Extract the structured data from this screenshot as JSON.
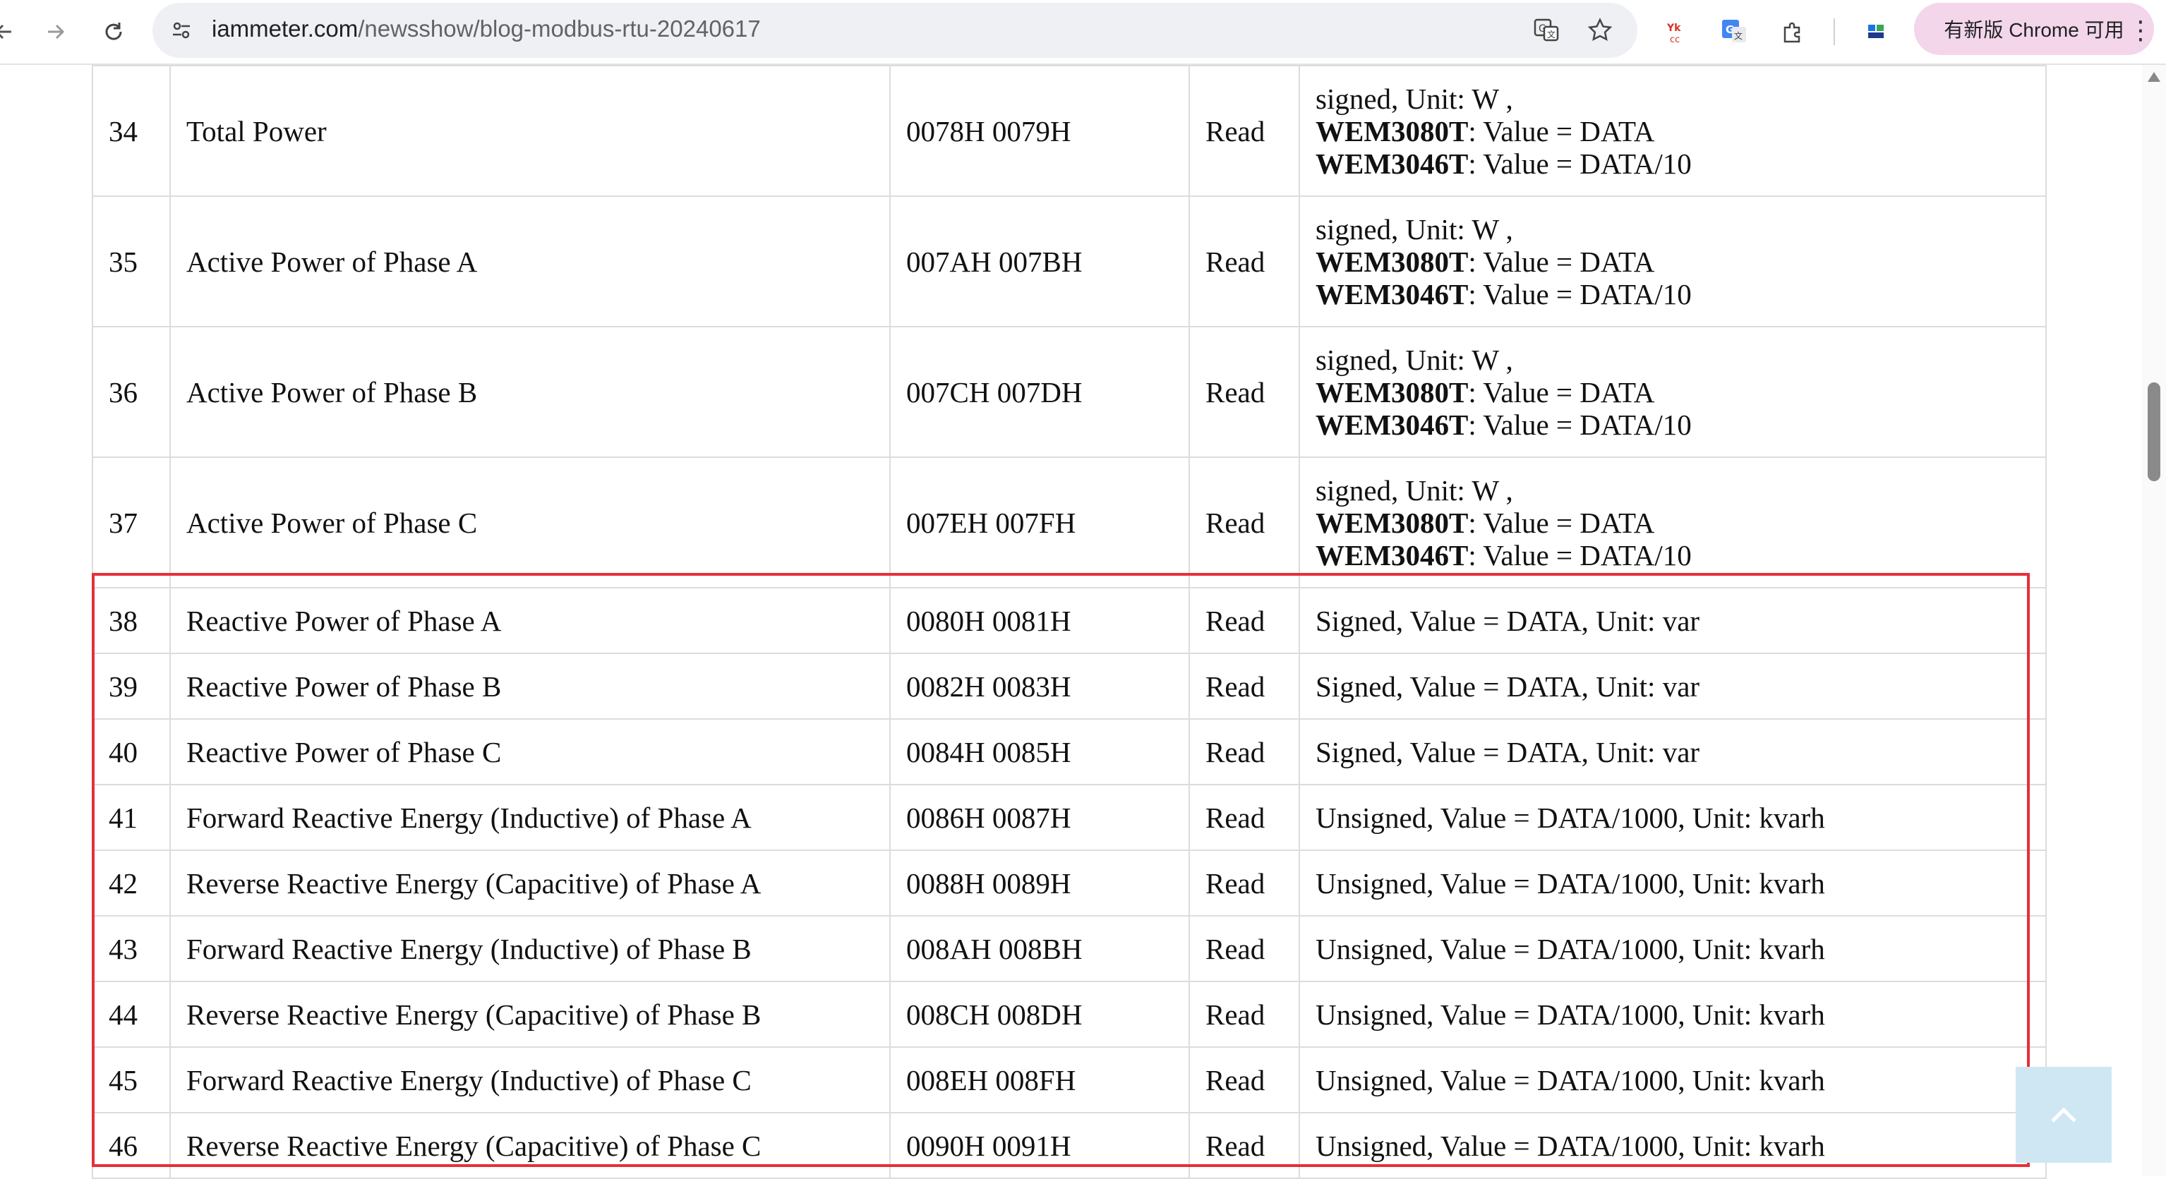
{
  "browser": {
    "url_domain": "iammeter.com",
    "url_path": "/newsshow/blog-modbus-rtu-20240617",
    "update_button": "有新版 Chrome 可用"
  },
  "table": {
    "rows": [
      {
        "no": "34",
        "name": "Total Power",
        "address": "0078H 0079H",
        "access": "Read",
        "desc": {
          "line1": "signed, Unit: W ,",
          "model1": "WEM3080T",
          "val1": ": Value = DATA",
          "model2": "WEM3046T",
          "val2": ": Value = DATA/10"
        }
      },
      {
        "no": "35",
        "name": "Active Power of Phase A",
        "address": "007AH 007BH",
        "access": "Read",
        "desc": {
          "line1": "signed, Unit: W ,",
          "model1": "WEM3080T",
          "val1": ": Value = DATA",
          "model2": "WEM3046T",
          "val2": ": Value = DATA/10"
        }
      },
      {
        "no": "36",
        "name": "Active Power of Phase B",
        "address": "007CH 007DH",
        "access": "Read",
        "desc": {
          "line1": "signed, Unit: W ,",
          "model1": "WEM3080T",
          "val1": ": Value = DATA",
          "model2": "WEM3046T",
          "val2": ": Value = DATA/10"
        }
      },
      {
        "no": "37",
        "name": "Active Power of Phase C",
        "address": "007EH 007FH",
        "access": "Read",
        "desc": {
          "line1": "signed, Unit: W ,",
          "model1": "WEM3080T",
          "val1": ": Value = DATA",
          "model2": "WEM3046T",
          "val2": ": Value = DATA/10"
        }
      },
      {
        "no": "38",
        "name": "Reactive Power of Phase A",
        "address": "0080H 0081H",
        "access": "Read",
        "desc_text": "Signed, Value = DATA, Unit: var"
      },
      {
        "no": "39",
        "name": "Reactive Power of Phase B",
        "address": "0082H 0083H",
        "access": "Read",
        "desc_text": "Signed, Value = DATA, Unit: var"
      },
      {
        "no": "40",
        "name": "Reactive Power of Phase C",
        "address": "0084H 0085H",
        "access": "Read",
        "desc_text": "Signed, Value = DATA, Unit: var"
      },
      {
        "no": "41",
        "name": "Forward Reactive Energy (Inductive) of Phase A",
        "address": "0086H 0087H",
        "access": "Read",
        "desc_text": "Unsigned, Value = DATA/1000, Unit: kvarh"
      },
      {
        "no": "42",
        "name": "Reverse Reactive Energy (Capacitive) of Phase A",
        "address": "0088H 0089H",
        "access": "Read",
        "desc_text": "Unsigned, Value = DATA/1000, Unit: kvarh"
      },
      {
        "no": "43",
        "name": "Forward Reactive Energy (Inductive) of Phase B",
        "address": "008AH 008BH",
        "access": "Read",
        "desc_text": "Unsigned, Value = DATA/1000, Unit: kvarh"
      },
      {
        "no": "44",
        "name": "Reverse Reactive Energy (Capacitive) of Phase B",
        "address": "008CH 008DH",
        "access": "Read",
        "desc_text": "Unsigned, Value = DATA/1000, Unit: kvarh"
      },
      {
        "no": "45",
        "name": "Forward Reactive Energy (Inductive) of Phase C",
        "address": "008EH 008FH",
        "access": "Read",
        "desc_text": "Unsigned, Value = DATA/1000, Unit: kvarh"
      },
      {
        "no": "46",
        "name": "Reverse Reactive Energy (Capacitive) of Phase C",
        "address": "0090H 0091H",
        "access": "Read",
        "desc_text": "Unsigned, Value = DATA/1000, Unit: kvarh"
      }
    ]
  },
  "colors": {
    "highlight_box": "#e5303a",
    "back_to_top_bg": "#cfe7f3",
    "update_pill_bg": "#f3d6ea"
  },
  "icons": {
    "back": "back-arrow-icon",
    "forward": "forward-arrow-icon",
    "reload": "reload-icon",
    "site_info": "site-info-icon",
    "translate": "translate-icon",
    "bookmark": "star-icon",
    "ext1": "extension-icon",
    "ext2": "google-translate-icon",
    "extensions": "puzzle-icon",
    "ext3": "extension-icon",
    "menu": "kebab-menu-icon",
    "back_to_top": "chevron-up-icon"
  }
}
